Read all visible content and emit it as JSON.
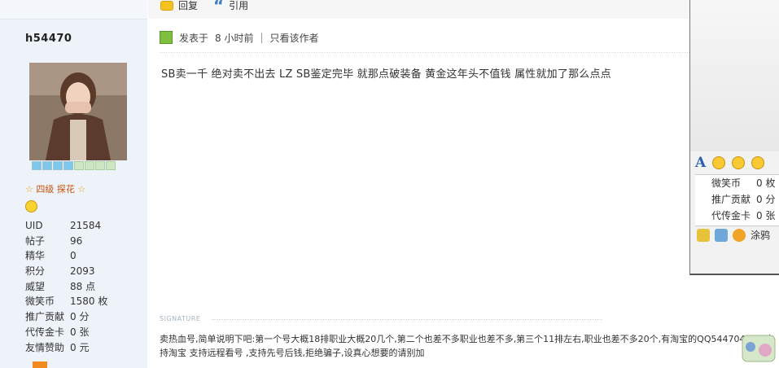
{
  "toolbar": {
    "reply_label": "回复",
    "quote_label": "引用"
  },
  "user": {
    "name": "h54470",
    "rank": "四级 探花",
    "stats": [
      {
        "label": "UID",
        "value": "21584"
      },
      {
        "label": "帖子",
        "value": "96"
      },
      {
        "label": "精华",
        "value": "0"
      },
      {
        "label": "积分",
        "value": "2093"
      },
      {
        "label": "威望",
        "value": "88 点"
      },
      {
        "label": "微笑币",
        "value": "1580 枚"
      },
      {
        "label": "推广贡献",
        "value": "0 分"
      },
      {
        "label": "代传金卡",
        "value": "0 张"
      },
      {
        "label": "友情赞助",
        "value": "0 元"
      }
    ],
    "level_filled": 4,
    "level_total": 8
  },
  "post": {
    "posted": "发表于",
    "time": "8 小时前",
    "sep": "|",
    "only_author": "只看该作者",
    "content": "SB卖一千  绝对卖不出去  LZ SB鉴定完毕  就那点破装备  黄金这年头不值钱  属性就加了那么点点"
  },
  "signature": {
    "label": "SIGNATURE",
    "text": "卖热血号,简单说明下吧:第一个号大概18排职业大概20几个,第二个也差不多职业也差不多,第三个11排左右,职业也差不多20个,有淘宝的QQ544704016,支持淘宝 支持远程看号  ,支持先号后钱,拒绝骗子,设真心想要的请别加"
  },
  "panel": {
    "rows": [
      {
        "label": "微笑币",
        "value": "0 枚"
      },
      {
        "label": "推广贡献",
        "value": "0 分"
      },
      {
        "label": "代传金卡",
        "value": "0 张"
      }
    ],
    "bottom_label": "涂鸦"
  },
  "colors": {
    "accent": "#3f7fbf",
    "rank": "#c8520a",
    "sidebar_bg": "#eef3f9"
  }
}
